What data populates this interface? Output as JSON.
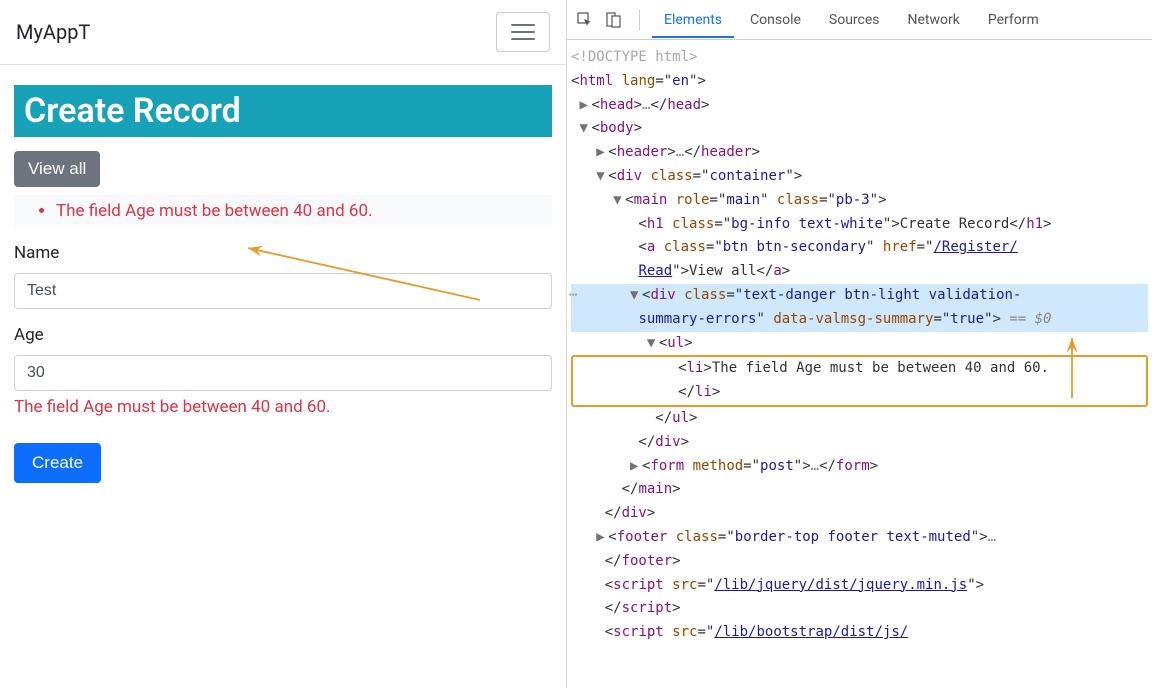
{
  "navbar": {
    "brand": "MyAppT"
  },
  "page": {
    "title": "Create Record",
    "view_all_label": "View all",
    "validation_summary_item": "The field Age must be between 40 and 60.",
    "name_label": "Name",
    "name_value": "Test",
    "age_label": "Age",
    "age_value": "30",
    "age_error": "The field Age must be between 40 and 60.",
    "submit_label": "Create"
  },
  "devtools": {
    "tabs": {
      "elements": "Elements",
      "console": "Console",
      "sources": "Sources",
      "network": "Network",
      "perform": "Perform"
    },
    "dom": {
      "doctype": "<!DOCTYPE html>",
      "html_open": "html",
      "html_lang": "en",
      "head": "head",
      "body": "body",
      "header": "header",
      "div_container_class": "container",
      "main_role": "main",
      "main_class": "pb-3",
      "h1_class": "bg-info text-white",
      "h1_text": "Create Record",
      "a_class": "btn btn-secondary",
      "a_href": "/Register/Read",
      "a_text": "View all",
      "valdiv_class": "text-danger btn-light validation-summary-errors",
      "valdiv_attr": "data-valmsg-summary",
      "valdiv_val": "true",
      "eqdollar": " == $0",
      "li_text": "The field Age must be between 40 and 60.",
      "form_method": "post",
      "footer_class": "border-top footer text-muted",
      "script1_src": "/lib/jquery/dist/jquery.min.js",
      "script2_src": "/lib/bootstrap/dist/js/"
    }
  }
}
